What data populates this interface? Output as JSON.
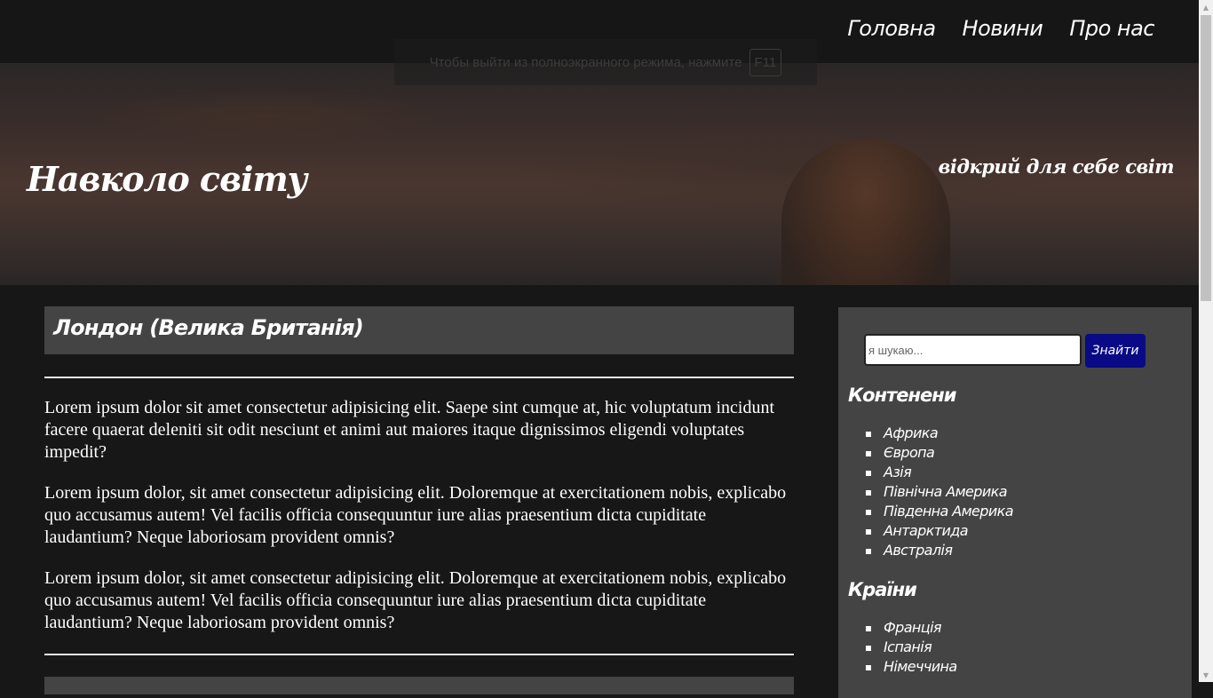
{
  "nav": {
    "items": [
      {
        "label": "Головна"
      },
      {
        "label": "Новини"
      },
      {
        "label": "Про нас"
      }
    ]
  },
  "fullscreen_hint": {
    "message": "Чтобы выйти из полноэкранного режима, нажмите",
    "key": "F11"
  },
  "hero": {
    "title": "Навколо світу",
    "tagline": "відкрий для себе світ"
  },
  "article": {
    "title": "Лондон (Велика Британія)",
    "paragraphs": [
      "Lorem ipsum dolor sit amet consectetur adipisicing elit. Saepe sint cumque at, hic voluptatum incidunt facere quaerat deleniti sit odit nesciunt et animi aut maiores itaque dignissimos eligendi voluptates impedit?",
      "Lorem ipsum dolor, sit amet consectetur adipisicing elit. Doloremque at exercitationem nobis, explicabo quo accusamus autem! Vel facilis officia consequuntur iure alias praesentium dicta cupiditate laudantium? Neque laboriosam provident omnis?",
      "Lorem ipsum dolor, sit amet consectetur adipisicing elit. Doloremque at exercitationem nobis, explicabo quo accusamus autem! Vel facilis officia consequuntur iure alias praesentium dicta cupiditate laudantium? Neque laboriosam provident omnis?"
    ]
  },
  "sidebar": {
    "search": {
      "placeholder": "я шукаю...",
      "value": "",
      "button_label": "Знайти"
    },
    "continents": {
      "heading": "Контенени",
      "items": [
        {
          "label": "Африка"
        },
        {
          "label": "Європа"
        },
        {
          "label": "Азія"
        },
        {
          "label": "Північна Америка"
        },
        {
          "label": "Південна Америка"
        },
        {
          "label": "Антарктида"
        },
        {
          "label": "Австралія"
        }
      ]
    },
    "countries": {
      "heading": "Країни",
      "items": [
        {
          "label": "Франція"
        },
        {
          "label": "Іспанія"
        },
        {
          "label": "Німеччина"
        }
      ]
    }
  },
  "colors": {
    "page_bg": "#171717",
    "panel_bg": "#444444",
    "search_button": "#0a0a86",
    "text": "#ffffff"
  }
}
